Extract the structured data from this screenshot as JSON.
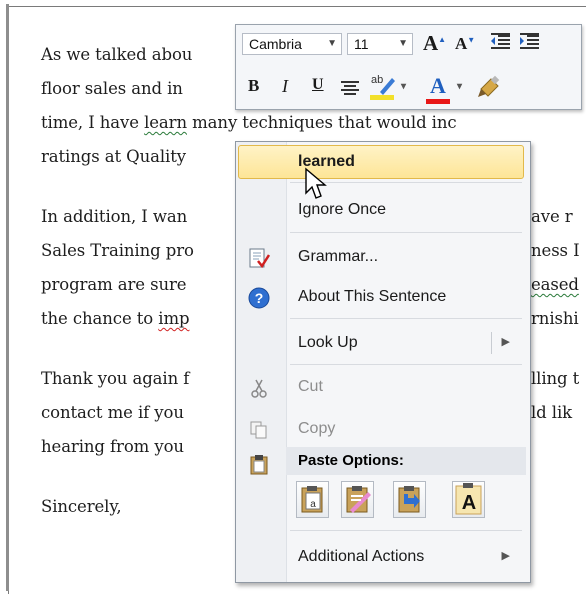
{
  "document": {
    "lines": [
      "As we talked abou",
      "floor sales and in",
      "time, I have ",
      "ratings at Quality",
      "In addition, I wan",
      "Sales Training pro",
      "program are sure",
      "the chance to imp",
      "Thank you again f",
      "contact me if you",
      "hearing from you",
      "Sincerely,"
    ],
    "line3_learn": "learn",
    "line3_rest": " many techniques that would inc",
    "line8_imp": "imp",
    "right_fragments": [
      "ave r",
      "ness I",
      "eased",
      "rnishi",
      "lling t",
      "ld lik"
    ]
  },
  "mini_toolbar": {
    "font_name": "Cambria",
    "font_size": "11",
    "grow_font": "A",
    "shrink_font": "A",
    "bold": "B",
    "italic": "I",
    "underline": "U",
    "font_color_glyph": "A",
    "highlight_glyph": "ab",
    "accent_colors": {
      "font_color": "#e81818",
      "highlight": "#f2e02a"
    }
  },
  "context_menu": {
    "items": [
      {
        "label": "learned",
        "highlighted": true
      },
      {
        "label": "Ignore Once"
      },
      {
        "label": "Grammar..."
      },
      {
        "label": "About This Sentence"
      },
      {
        "label": "Look Up",
        "submenu": true
      },
      {
        "label": "Cut",
        "disabled": true
      },
      {
        "label": "Copy",
        "disabled": true
      },
      {
        "label": "Paste Options:"
      },
      {
        "label": "Additional Actions",
        "submenu": true
      }
    ],
    "paste_icons": [
      "keep-source-formatting-icon",
      "merge-formatting-icon",
      "keep-text-only-arrow-icon",
      "keep-text-only-icon"
    ]
  }
}
